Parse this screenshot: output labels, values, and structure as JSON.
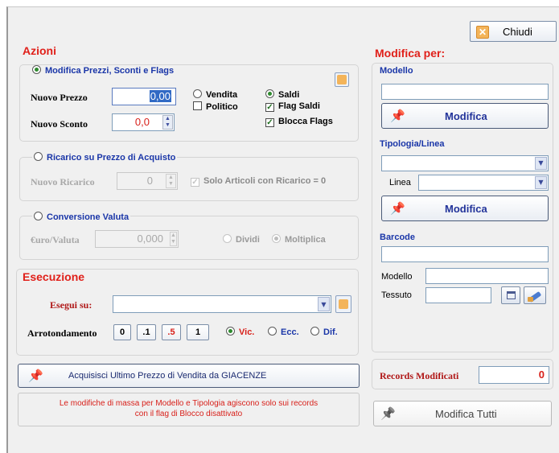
{
  "close_button": {
    "label": "Chiudi",
    "icon": "x-icon"
  },
  "azioni": {
    "title": "Azioni",
    "modifica_prezzi": {
      "label": "Modifica Prezzi, Sconti e Flags",
      "selected": true,
      "nuovo_prezzo_label": "Nuovo Prezzo",
      "nuovo_prezzo_value": "0,00",
      "nuovo_sconto_label": "Nuovo Sconto",
      "nuovo_sconto_value": "0,0",
      "vendita_label": "Vendita",
      "vendita_selected": false,
      "saldi_label": "Saldi",
      "saldi_selected": true,
      "politico_label": "Politico",
      "politico_checked": false,
      "flag_saldi_label": "Flag Saldi",
      "flag_saldi_checked": true,
      "blocca_flags_label": "Blocca Flags",
      "blocca_flags_checked": true
    },
    "ricarico": {
      "label": "Ricarico su Prezzo di Acquisto",
      "selected": false,
      "nuovo_ricarico_label": "Nuovo Ricarico",
      "nuovo_ricarico_value": "0",
      "solo_articoli_label": "Solo Articoli con Ricarico = 0",
      "solo_articoli_checked": true
    },
    "conversione": {
      "label": "Conversione Valuta",
      "selected": false,
      "euro_valuta_label": "€uro/Valuta",
      "euro_valuta_value": "0,000",
      "dividi_label": "Dividi",
      "dividi_selected": false,
      "moltiplica_label": "Moltiplica",
      "moltiplica_selected": true
    }
  },
  "esecuzione": {
    "title": "Esecuzione",
    "esegui_su_label": "Esegui su:",
    "esegui_su_value": "",
    "arrotondamento_label": "Arrotondamento",
    "round_buttons": [
      "0",
      ".1",
      ".5",
      "1"
    ],
    "vic_label": "Vic.",
    "vic_selected": true,
    "ecc_label": "Ecc.",
    "dif_label": "Dif."
  },
  "acquisisci_button": {
    "label": "Acquisisci Ultimo Prezzo di Vendita da GIACENZE"
  },
  "info_message": {
    "line1": "Le modifiche di massa per Modello e Tipologia agiscono solo sui records",
    "line2": "con il flag di Blocco disattivato"
  },
  "modifica_per": {
    "title": "Modifica per:",
    "modello_label": "Modello",
    "modello_value": "",
    "modifica_button_1": "Modifica",
    "tipologia_label": "Tipologia/Linea",
    "tipologia_value": "",
    "linea_label": "Linea",
    "linea_value": "",
    "modifica_button_2": "Modifica",
    "barcode_label": "Barcode",
    "barcode_value": "",
    "modello_sub_label": "Modello",
    "modello_sub_value": "",
    "tessuto_label": "Tessuto",
    "tessuto_value": ""
  },
  "records": {
    "label": "Records Modificati",
    "value": "0"
  },
  "modifica_tutti_button": {
    "label": "Modifica Tutti"
  },
  "colors": {
    "section_title": "#e0201a",
    "subsection_title": "#1a36a8",
    "accent_icon": "#f0a030"
  }
}
